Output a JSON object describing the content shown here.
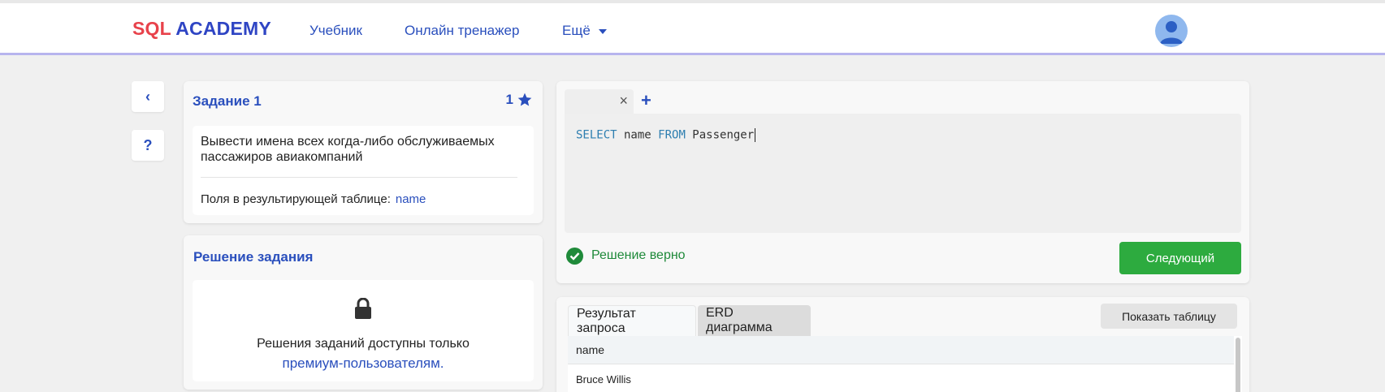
{
  "header": {
    "logo_part1": "SQL",
    "logo_part2": "ACADEMY",
    "nav": {
      "tutorial": "Учебник",
      "trainer": "Онлайн тренажер",
      "more": "Ещё"
    }
  },
  "sidebar": {
    "back_label": "‹",
    "help_label": "?"
  },
  "task": {
    "title": "Задание 1",
    "stars": "1",
    "description": "Вывести имена всех когда-либо обслуживаемых пассажиров авиакомпаний",
    "fields_label": "Поля в результирующей таблице:",
    "fields_value": "name"
  },
  "solution": {
    "title": "Решение задания",
    "locked_text": "Решения заданий доступны только",
    "locked_link": "премиум-пользователям."
  },
  "editor": {
    "close_tab": "×",
    "add_tab": "+",
    "code": {
      "kw1": "SELECT",
      "p1": " name ",
      "kw2": "FROM",
      "p2": " Passenger"
    },
    "status_text": "Решение верно",
    "next_button": "Следующий"
  },
  "results": {
    "tabs": [
      "Результат запроса",
      "ERD диаграмма"
    ],
    "show_table_button": "Показать таблицу",
    "columns": [
      "name"
    ],
    "rows": [
      [
        "Bruce Willis"
      ]
    ]
  },
  "colors": {
    "accent": "#2a4fbd",
    "success": "#1f8a3a",
    "button_green": "#2dab3f",
    "logo_red": "#e8424b"
  }
}
